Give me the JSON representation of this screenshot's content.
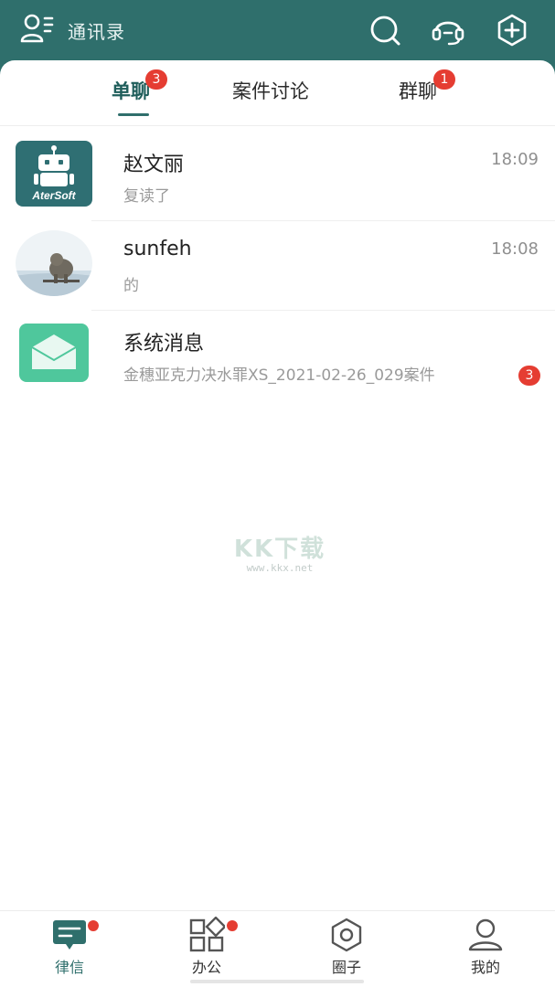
{
  "header": {
    "contacts_label": "通讯录",
    "icons": [
      "contacts-icon",
      "search-icon",
      "headset-icon",
      "add-icon"
    ]
  },
  "tabs": [
    {
      "label": "单聊",
      "badge": "3",
      "active": true
    },
    {
      "label": "案件讨论",
      "badge": "",
      "active": false
    },
    {
      "label": "群聊",
      "badge": "1",
      "active": false
    }
  ],
  "conversations": [
    {
      "name": "赵文丽",
      "time": "18:09",
      "message": "复读了",
      "avatar": "robot-avatar",
      "avatar_text": "AterSoft"
    },
    {
      "name": "sunfeh",
      "time": "18:08",
      "message": "的",
      "avatar": "elephant-photo-avatar"
    },
    {
      "name": "系统消息",
      "time": "",
      "message": "金穗亚克力决水罪XS_2021-02-26_029案件",
      "avatar": "envelope-avatar",
      "badge": "3"
    }
  ],
  "watermark": {
    "big": "KK下载",
    "small": "www.kkx.net"
  },
  "bottom_nav": [
    {
      "label": "律信",
      "icon": "chat-icon",
      "active": true,
      "dot": true
    },
    {
      "label": "办公",
      "icon": "apps-icon",
      "active": false,
      "dot": true
    },
    {
      "label": "圈子",
      "icon": "hexagon-icon",
      "active": false,
      "dot": false
    },
    {
      "label": "我的",
      "icon": "profile-icon",
      "active": false,
      "dot": false
    }
  ],
  "colors": {
    "primary": "#2f6f6c",
    "badge": "#e53d32",
    "background": "#ffffff"
  }
}
